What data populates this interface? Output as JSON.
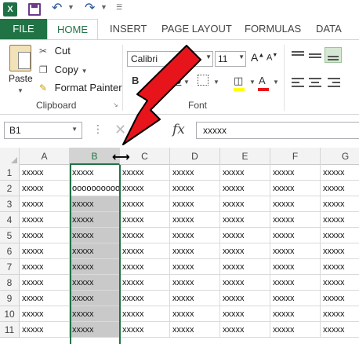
{
  "qat": {
    "app_badge": "X"
  },
  "tabs": [
    "FILE",
    "HOME",
    "INSERT",
    "PAGE LAYOUT",
    "FORMULAS",
    "DATA"
  ],
  "clipboard": {
    "paste": "Paste",
    "cut": "Cut",
    "copy": "Copy",
    "format_painter": "Format Painter",
    "label": "Clipboard"
  },
  "font": {
    "name": "Calibri",
    "size": "11",
    "label": "Font",
    "bold": "B",
    "italic": "I",
    "underline": "U",
    "font_color_letter": "A",
    "highlight_letter": "A"
  },
  "formula_bar": {
    "name_box": "B1",
    "fx": "fx",
    "content": "xxxxx"
  },
  "columns": [
    "A",
    "B",
    "C",
    "D",
    "E",
    "F",
    "G"
  ],
  "rows": [
    "1",
    "2",
    "3",
    "4",
    "5",
    "6",
    "7",
    "8",
    "9",
    "10",
    "11"
  ],
  "cells": {
    "col_a": "xxxxx",
    "col_b_row1": "xxxxx",
    "col_b_row2": "oooooooooo",
    "col_b_rest": "xxxxx",
    "col_c": "xxxxx",
    "col_d": "xxxxx",
    "col_e": "xxxxx",
    "col_f": "xxxxx",
    "col_g": "xxxxx"
  },
  "colors": {
    "excel_green": "#217346",
    "arrow_red": "#e8141b",
    "selection_gray": "#c9c9c9"
  },
  "icons": [
    "excel-logo-icon",
    "save-icon",
    "undo-icon",
    "redo-icon",
    "scissors-icon",
    "copy-icon",
    "paintbrush-icon",
    "resize-column-cursor-icon",
    "red-arrow-annotation"
  ]
}
